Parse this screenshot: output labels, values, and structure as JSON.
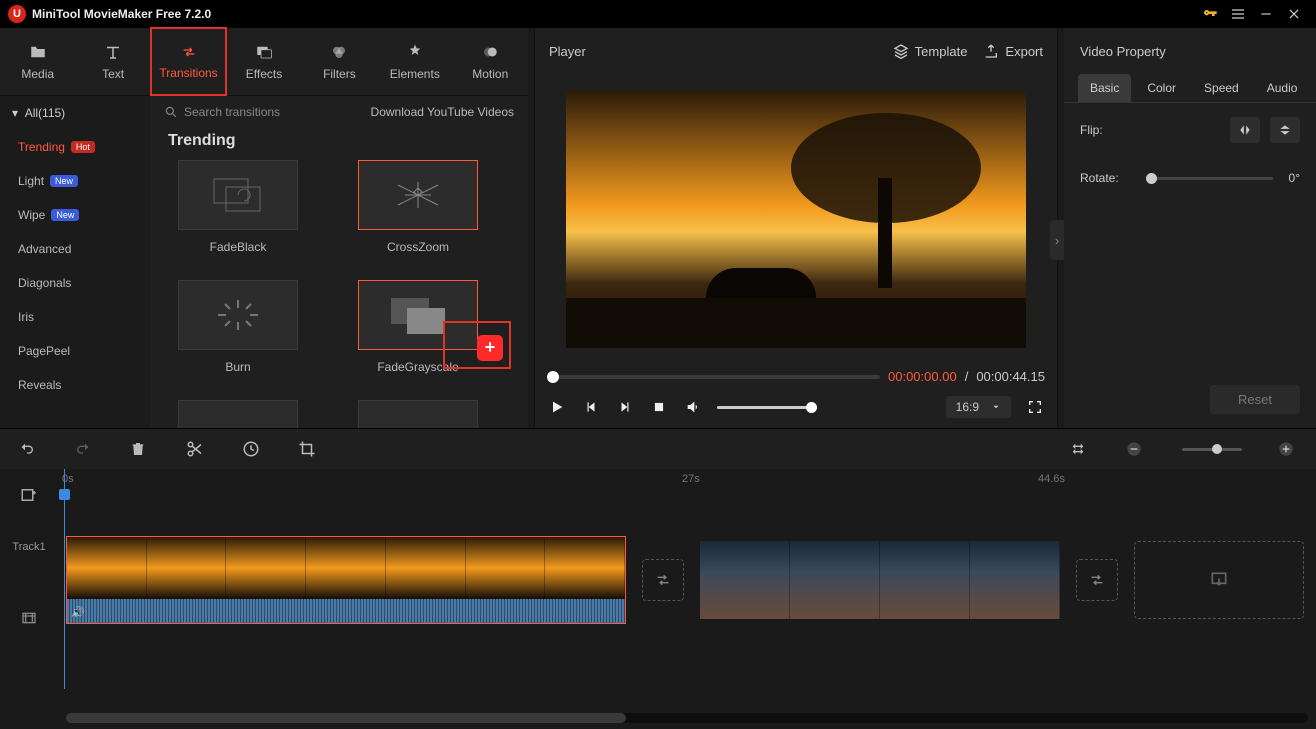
{
  "app": {
    "title": "MiniTool MovieMaker Free 7.2.0"
  },
  "tabs": [
    {
      "label": "Media"
    },
    {
      "label": "Text"
    },
    {
      "label": "Transitions"
    },
    {
      "label": "Effects"
    },
    {
      "label": "Filters"
    },
    {
      "label": "Elements"
    },
    {
      "label": "Motion"
    }
  ],
  "activeTab": 2,
  "categories": {
    "header": "All(115)",
    "items": [
      {
        "label": "Trending",
        "badge": "Hot",
        "badgeClass": "hot",
        "active": true
      },
      {
        "label": "Light",
        "badge": "New",
        "badgeClass": "new"
      },
      {
        "label": "Wipe",
        "badge": "New",
        "badgeClass": "new"
      },
      {
        "label": "Advanced"
      },
      {
        "label": "Diagonals"
      },
      {
        "label": "Iris"
      },
      {
        "label": "PagePeel"
      },
      {
        "label": "Reveals"
      }
    ]
  },
  "search": {
    "placeholder": "Search transitions"
  },
  "downloadLink": "Download YouTube Videos",
  "gridTitle": "Trending",
  "gridItems": [
    {
      "label": "FadeBlack",
      "selected": false
    },
    {
      "label": "CrossZoom",
      "selected": true
    },
    {
      "label": "Burn",
      "selected": false
    },
    {
      "label": "FadeGrayscale",
      "selected": true,
      "showAdd": true
    }
  ],
  "player": {
    "title": "Player",
    "template": "Template",
    "export": "Export",
    "currentTime": "00:00:00.00",
    "totalTime": "00:00:44.15",
    "ratio": "16:9"
  },
  "property": {
    "title": "Video Property",
    "tabs": [
      "Basic",
      "Color",
      "Speed",
      "Audio"
    ],
    "activeTab": 0,
    "flipLabel": "Flip:",
    "rotateLabel": "Rotate:",
    "rotateValue": "0°",
    "reset": "Reset"
  },
  "timeline": {
    "marks": [
      {
        "label": "0s",
        "pos": 4
      },
      {
        "label": "27s",
        "pos": 624
      },
      {
        "label": "44.6s",
        "pos": 980
      }
    ],
    "track1": "Track1"
  }
}
